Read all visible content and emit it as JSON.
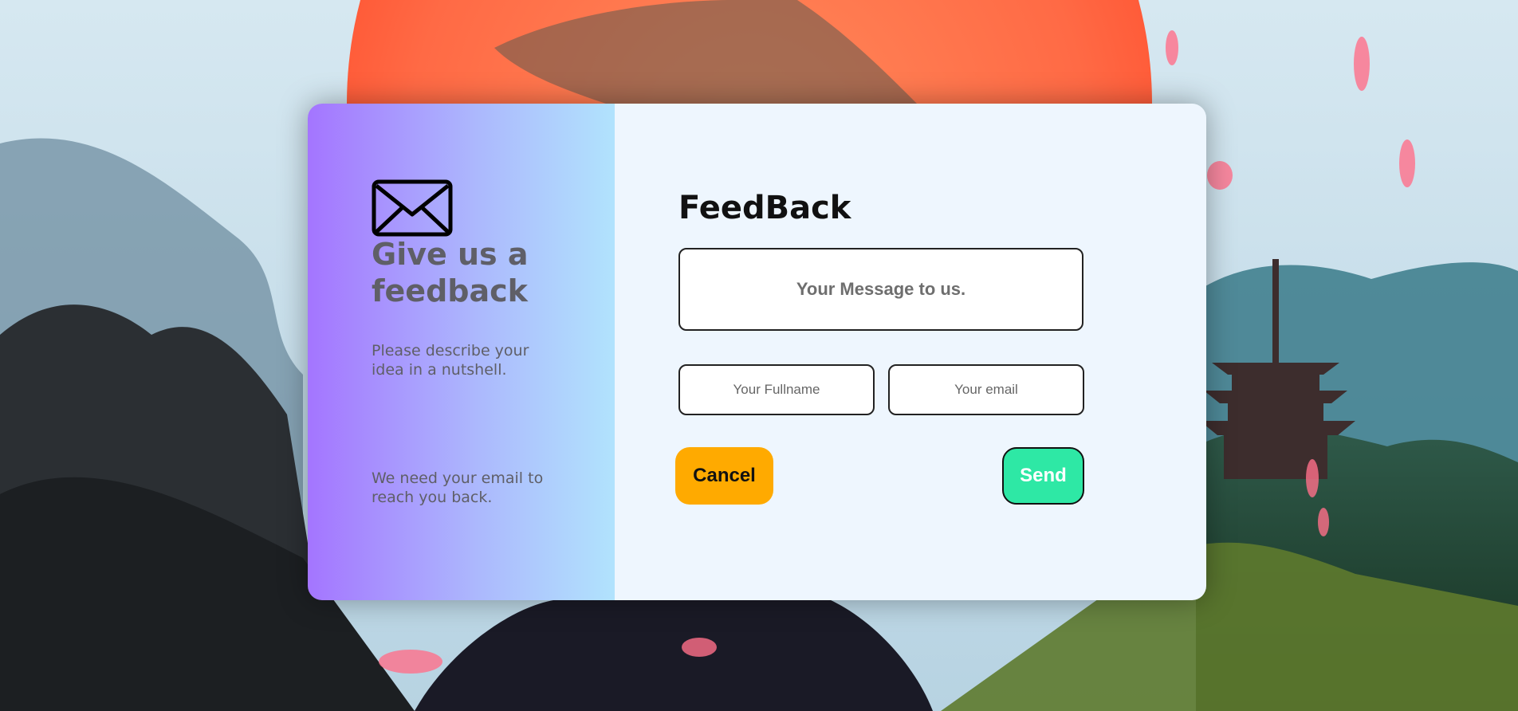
{
  "left_panel": {
    "icon": "envelope-icon",
    "title": "Give us a feedback",
    "description": "Please describe your idea in a nutshell.",
    "email_note": "We need your email to reach you back."
  },
  "form": {
    "title": "FeedBack",
    "message_placeholder": "Your Message to us.",
    "fullname_placeholder": "Your Fullname",
    "email_placeholder": "Your email",
    "cancel_label": "Cancel",
    "send_label": "Send"
  },
  "colors": {
    "left_gradient_start": "#a475ff",
    "left_gradient_end": "#b1e3fd",
    "form_background": "#eef6fe",
    "cancel_button": "#ffaa00",
    "send_button": "#2ee8a5"
  }
}
